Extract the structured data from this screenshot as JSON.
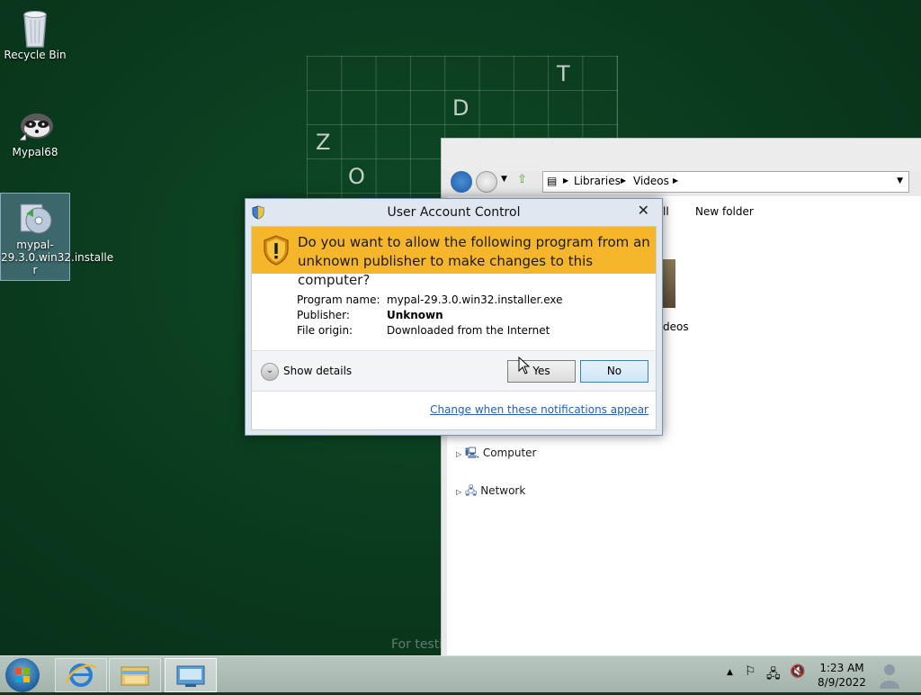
{
  "desktop": {
    "icons": [
      {
        "label": "Recycle Bin",
        "icon": "recycle-bin-icon"
      },
      {
        "label": "Mypal68",
        "icon": "mypal-icon"
      },
      {
        "label": "mypal-29.3.0.win32.installe r",
        "icon": "installer-icon"
      }
    ],
    "grid_letters": [
      "T",
      "D",
      "Z",
      "O"
    ],
    "watermark": "For testi"
  },
  "explorer": {
    "breadcrumb": [
      "Libraries",
      "Videos"
    ],
    "toolbar_new_folder": "New folder",
    "toolbar_partial": "ll",
    "item_partial": "deos",
    "tree": [
      "Computer",
      "Network"
    ]
  },
  "uac": {
    "title": "User Account Control",
    "question": "Do you want to allow the following program from an unknown publisher to make changes to this computer?",
    "fields": [
      {
        "label": "Program name:",
        "value": "mypal-29.3.0.win32.installer.exe",
        "bold": false
      },
      {
        "label": "Publisher:",
        "value": "Unknown",
        "bold": true
      },
      {
        "label": "File origin:",
        "value": "Downloaded from the Internet",
        "bold": false
      }
    ],
    "show_details": "Show details",
    "yes": "Yes",
    "no": "No",
    "change_link": "Change when these notifications appear",
    "banner_color": "#f6b62c"
  },
  "taskbar": {
    "time": "1:23 AM",
    "date": "8/9/2022",
    "pinned": [
      "start-orb-icon",
      "internet-explorer-icon",
      "file-explorer-icon",
      "control-panel-icon"
    ]
  }
}
